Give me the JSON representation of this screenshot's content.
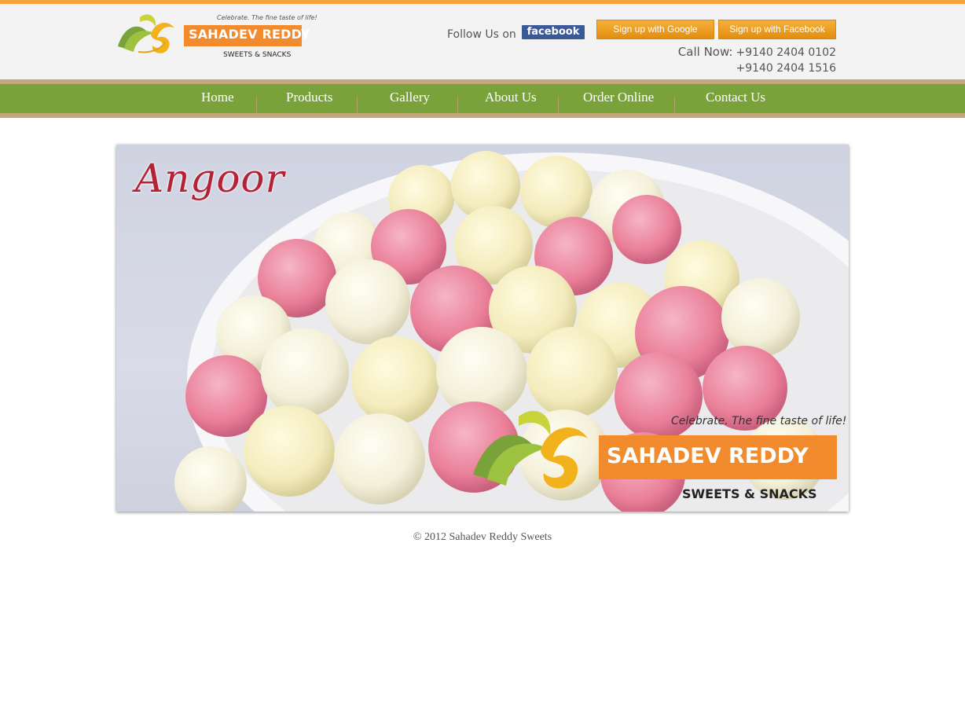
{
  "brand": {
    "tagline": "Celebrate. The fine taste of life!",
    "name": "SAHADEV REDDY",
    "subtitle": "SWEETS & SNACKS",
    "colors": {
      "orange": "#f28a2e",
      "green": "#7aa23a",
      "yellow": "#f5b13a"
    }
  },
  "header": {
    "follow_text": "Follow Us on",
    "facebook_badge": "facebook",
    "signup_google": "Sign up with Google",
    "signup_facebook": "Sign up with Facebook",
    "call_label": "Call Now:",
    "phone_1": "+9140 2404 0102",
    "phone_2": "+9140 2404 1516"
  },
  "nav": {
    "items": [
      {
        "label": "Home"
      },
      {
        "label": "Products"
      },
      {
        "label": "Gallery"
      },
      {
        "label": "About Us"
      },
      {
        "label": "Order Online"
      },
      {
        "label": "Contact Us"
      }
    ]
  },
  "banner": {
    "title": "Angoor",
    "logo_tagline": "Celebrate. The fine taste of life!",
    "logo_name": "SAHADEV REDDY",
    "logo_subtitle": "SWEETS & SNACKS"
  },
  "footer": {
    "text": "© 2012 Sahadev Reddy Sweets"
  }
}
